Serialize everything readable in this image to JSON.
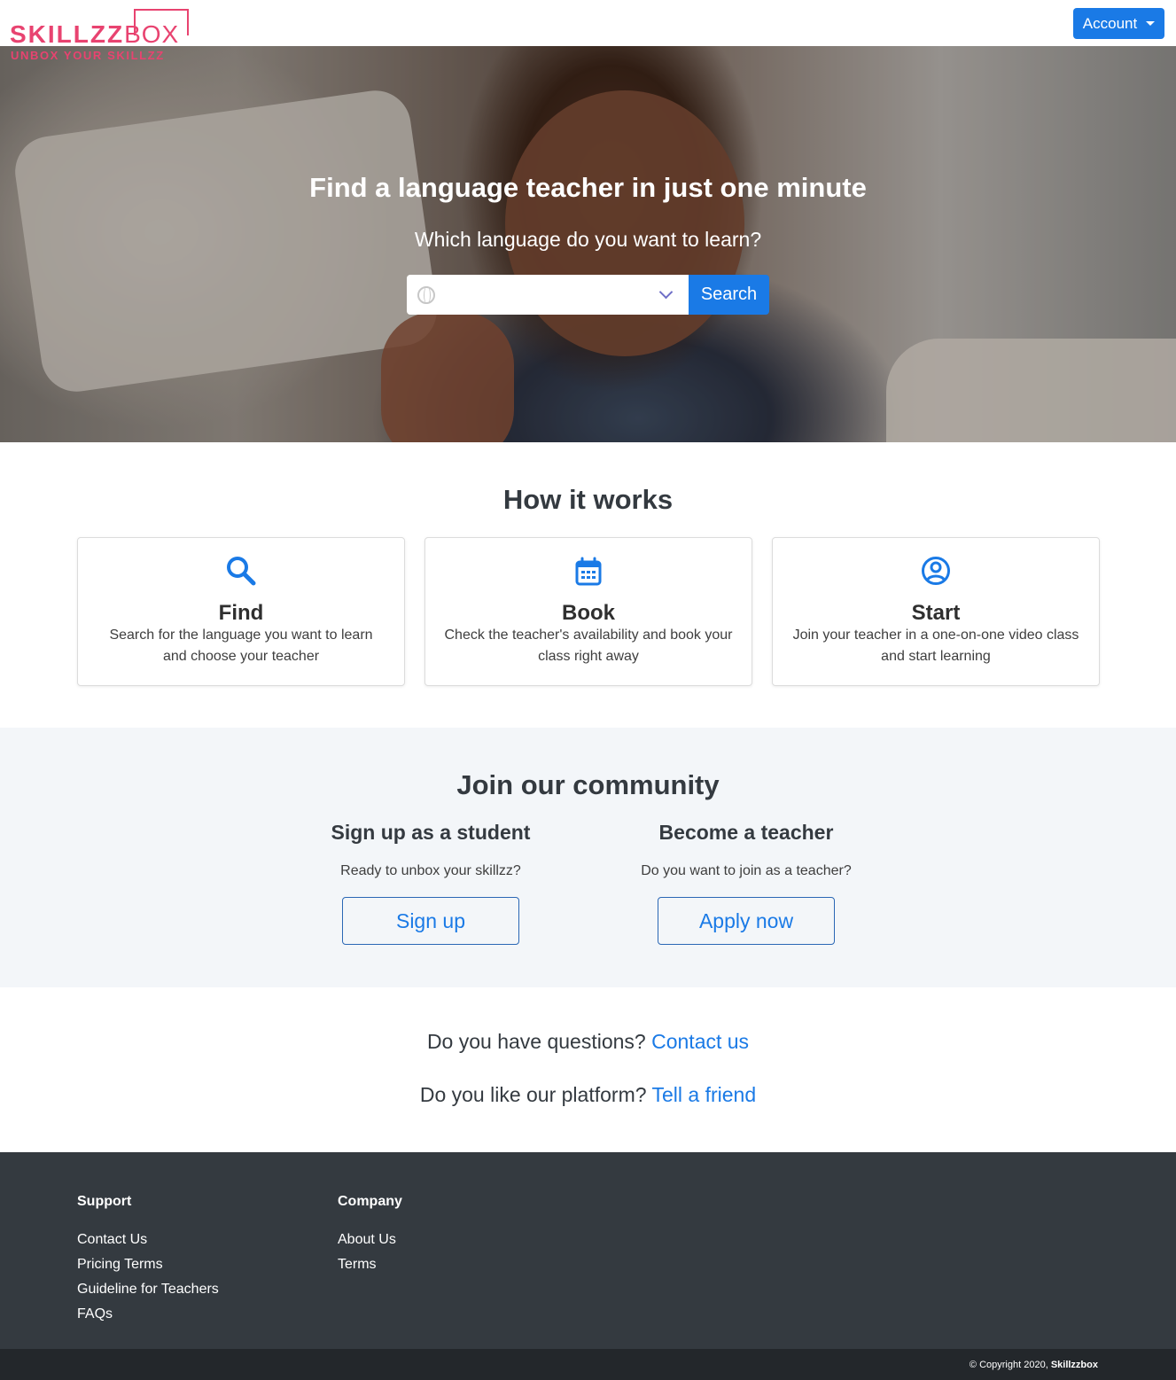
{
  "header": {
    "logo_word_main": "SKILLZZ",
    "logo_word_box": "BOX",
    "logo_tagline": "UNBOX YOUR SKILLZZ",
    "account_label": "Account"
  },
  "hero": {
    "title": "Find a language teacher in just one minute",
    "subtitle": "Which language do you want to learn?",
    "language_select_value": "",
    "search_label": "Search"
  },
  "how_it_works": {
    "title": "How it works",
    "cards": [
      {
        "icon": "search-icon",
        "title": "Find",
        "text": "Search for the language you want to learn and choose your teacher"
      },
      {
        "icon": "calendar-icon",
        "title": "Book",
        "text": "Check the teacher's availability and book your class right away"
      },
      {
        "icon": "user-circle-icon",
        "title": "Start",
        "text": "Join your teacher in a one-on-one video class and start learning"
      }
    ]
  },
  "community": {
    "title": "Join our community",
    "student": {
      "heading": "Sign up as a student",
      "question": "Ready to unbox your skillzz?",
      "button": "Sign up"
    },
    "teacher": {
      "heading": "Become a teacher",
      "question": "Do you want to join as a teacher?",
      "button": "Apply now"
    }
  },
  "questions": {
    "q1_text": "Do you have questions?",
    "q1_link": "Contact us",
    "q2_text": "Do you like our platform?",
    "q2_link": "Tell a friend"
  },
  "footer": {
    "support": {
      "title": "Support",
      "links": [
        "Contact Us",
        "Pricing Terms",
        "Guideline for Teachers",
        "FAQs"
      ]
    },
    "company": {
      "title": "Company",
      "links": [
        "About Us",
        "Terms"
      ]
    },
    "copyright_prefix": "© Copyright 2020,",
    "copyright_brand": "Skillzzbox"
  },
  "colors": {
    "brand_pink": "#e84370",
    "primary_blue": "#1a7ae6",
    "footer_dark": "#343a40",
    "community_bg": "#f3f6f9"
  }
}
